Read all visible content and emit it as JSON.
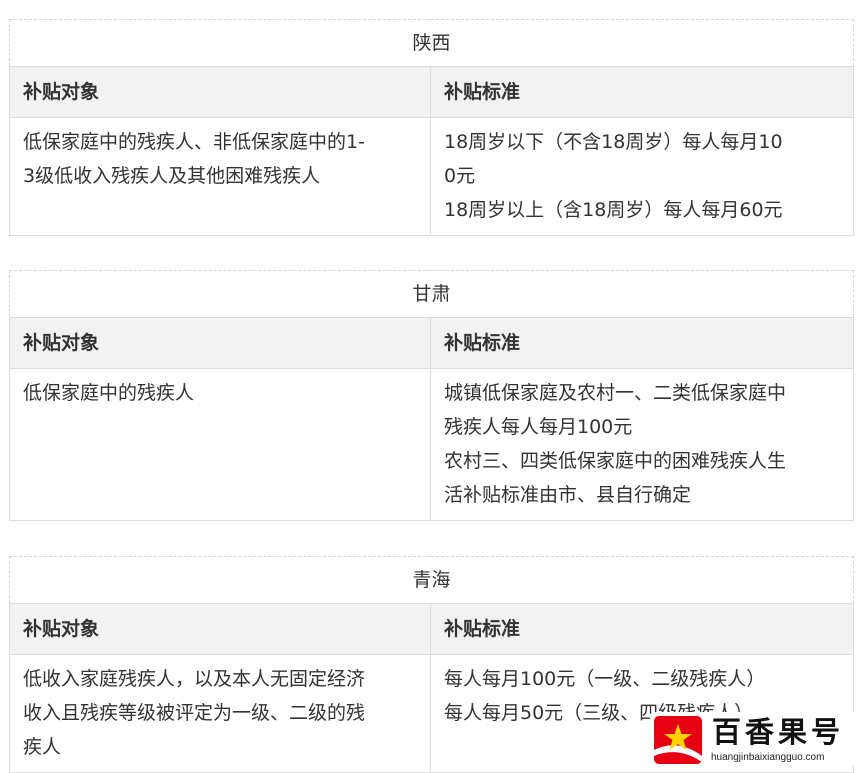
{
  "col_headers": [
    "补贴对象",
    "补贴标准"
  ],
  "sections": [
    {
      "province": "陕西",
      "target": [
        "低保家庭中的残疾人、非低保家庭中的1-",
        "3级低收入残疾人及其他困难残疾人"
      ],
      "standard": [
        "18周岁以下（不含18周岁）每人每月10",
        "0元",
        "18周岁以上（含18周岁）每人每月60元"
      ]
    },
    {
      "province": "甘肃",
      "target": [
        "低保家庭中的残疾人"
      ],
      "standard": [
        "城镇低保家庭及农村一、二类低保家庭中",
        "残疾人每人每月100元",
        "农村三、四类低保家庭中的困难残疾人生",
        "活补贴标准由市、县自行确定"
      ]
    },
    {
      "province": "青海",
      "target": [
        "低收入家庭残疾人，以及本人无固定经济",
        "收入且残疾等级被评定为一级、二级的残",
        "疾人"
      ],
      "standard": [
        "每人每月100元（一级、二级残疾人）",
        "每人每月50元（三级、四级残疾人）"
      ]
    }
  ],
  "watermark": {
    "name": "百香果号",
    "site": "huangjinbaixiangguo.com",
    "colors": {
      "red": "#e60012",
      "star": "#ffd200"
    }
  }
}
